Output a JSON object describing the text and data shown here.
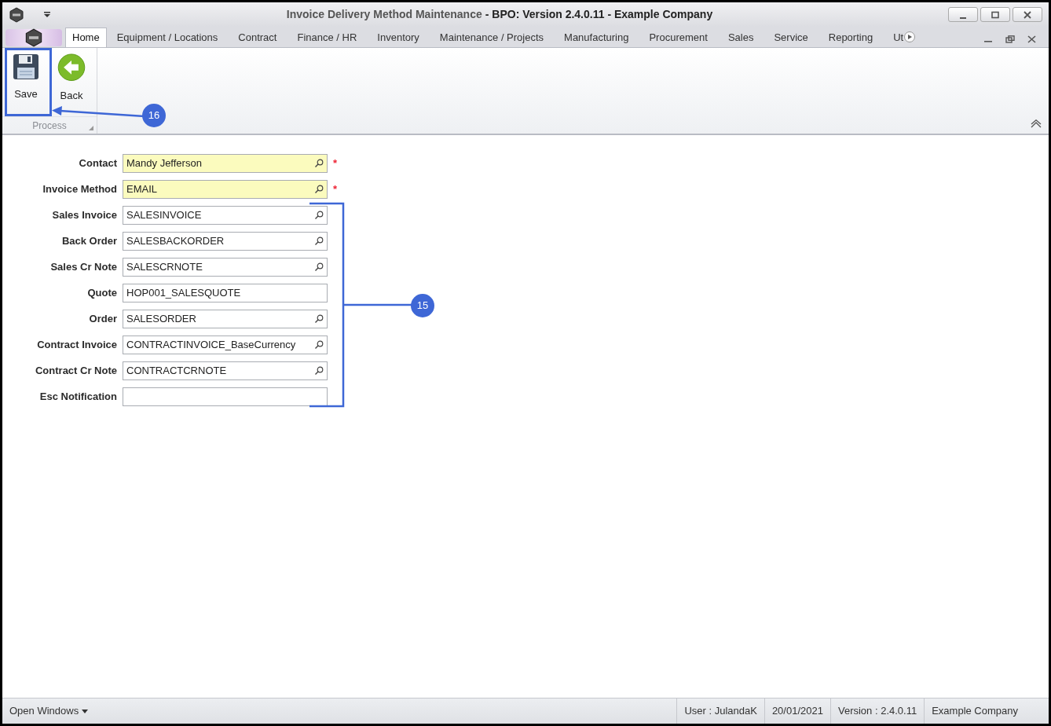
{
  "window": {
    "title": "Invoice Delivery Method Maintenance",
    "title_suffix": "- BPO: Version 2.4.0.11 - Example Company"
  },
  "tabs": [
    {
      "label": "Home",
      "selected": true
    },
    {
      "label": "Equipment / Locations",
      "selected": false
    },
    {
      "label": "Contract",
      "selected": false
    },
    {
      "label": "Finance / HR",
      "selected": false
    },
    {
      "label": "Inventory",
      "selected": false
    },
    {
      "label": "Maintenance / Projects",
      "selected": false
    },
    {
      "label": "Manufacturing",
      "selected": false
    },
    {
      "label": "Procurement",
      "selected": false
    },
    {
      "label": "Sales",
      "selected": false
    },
    {
      "label": "Service",
      "selected": false
    },
    {
      "label": "Reporting",
      "selected": false
    },
    {
      "label": "Ut",
      "selected": false
    }
  ],
  "ribbon": {
    "buttons": [
      {
        "kind": "save",
        "label": "Save"
      },
      {
        "kind": "back",
        "label": "Back"
      }
    ],
    "group": "Process"
  },
  "form": {
    "fields": [
      {
        "label": "Contact",
        "value": "Mandy Jefferson",
        "required": true,
        "lookup": true
      },
      {
        "label": "Invoice Method",
        "value": "EMAIL",
        "required": true,
        "lookup": true
      },
      {
        "label": "Sales Invoice",
        "value": "SALESINVOICE",
        "required": false,
        "lookup": true
      },
      {
        "label": "Back Order",
        "value": "SALESBACKORDER",
        "required": false,
        "lookup": true
      },
      {
        "label": "Sales Cr Note",
        "value": "SALESCRNOTE",
        "required": false,
        "lookup": true
      },
      {
        "label": "Quote",
        "value": "HOP001_SALESQUOTE",
        "required": false,
        "lookup": false
      },
      {
        "label": "Order",
        "value": "SALESORDER",
        "required": false,
        "lookup": true
      },
      {
        "label": "Contract Invoice",
        "value": "CONTRACTINVOICE_BaseCurrency",
        "required": false,
        "lookup": true
      },
      {
        "label": "Contract Cr Note",
        "value": "CONTRACTCRNOTE",
        "required": false,
        "lookup": true
      },
      {
        "label": "Esc Notification",
        "required": false,
        "lookup": false
      }
    ],
    "required_mark": "*"
  },
  "callouts": [
    {
      "kind": "arrow",
      "number": "16"
    },
    {
      "kind": "bracket",
      "number": "15"
    }
  ],
  "status_bar": {
    "open_windows": "Open Windows",
    "items": [
      "User : JulandaK",
      "20/01/2021",
      "Version : 2.4.0.11",
      "Example Company"
    ]
  }
}
